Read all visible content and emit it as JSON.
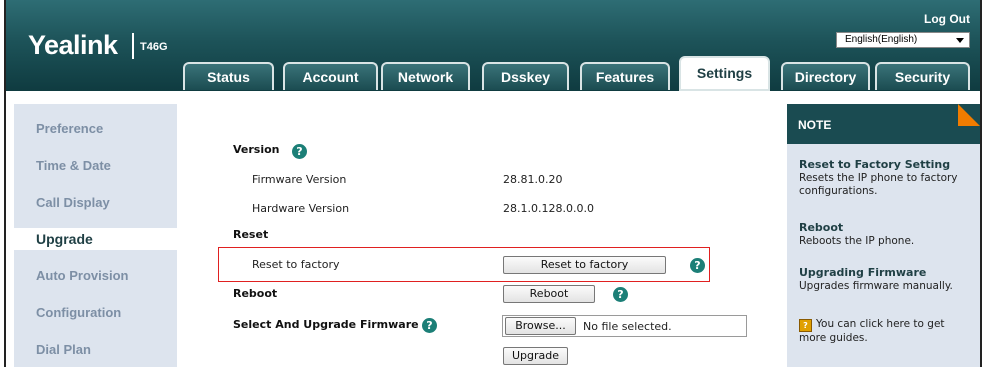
{
  "header": {
    "logo": "Yealink",
    "model": "T46G",
    "logout": "Log Out",
    "language": "English(English)"
  },
  "tabs": [
    {
      "label": "Status"
    },
    {
      "label": "Account"
    },
    {
      "label": "Network"
    },
    {
      "label": "Dsskey"
    },
    {
      "label": "Features"
    },
    {
      "label": "Settings",
      "active": true
    },
    {
      "label": "Directory"
    },
    {
      "label": "Security"
    }
  ],
  "sidebar": {
    "items": [
      {
        "label": "Preference"
      },
      {
        "label": "Time & Date"
      },
      {
        "label": "Call Display"
      },
      {
        "label": "Upgrade",
        "active": true
      },
      {
        "label": "Auto Provision"
      },
      {
        "label": "Configuration"
      },
      {
        "label": "Dial Plan"
      }
    ]
  },
  "main": {
    "version_label": "Version",
    "firmware_label": "Firmware Version",
    "firmware_value": "28.81.0.20",
    "hardware_label": "Hardware Version",
    "hardware_value": "28.1.0.128.0.0.0",
    "reset_label": "Reset",
    "reset_factory_label": "Reset to factory",
    "reset_factory_button": "Reset to factory",
    "reboot_label": "Reboot",
    "reboot_button": "Reboot",
    "upgrade_label": "Select And Upgrade Firmware",
    "browse_button": "Browse...",
    "file_status": "No file selected.",
    "upgrade_button": "Upgrade",
    "help_glyph": "?"
  },
  "note": {
    "title": "NOTE",
    "sections": [
      {
        "heading": "Reset to Factory Setting",
        "text": "Resets the IP phone to factory configurations."
      },
      {
        "heading": "Reboot",
        "text": "Reboots the IP phone."
      },
      {
        "heading": "Upgrading Firmware",
        "text": "Upgrades firmware manually."
      }
    ],
    "guide_text": "You can click here to get more guides."
  },
  "colors": {
    "header_dark": "#0f3b40",
    "header_light": "#2e6d74",
    "sidebar_bg": "#dde4ee",
    "help_icon": "#1c7f77",
    "highlight_border": "#e02020",
    "note_accent": "#f07c00"
  }
}
